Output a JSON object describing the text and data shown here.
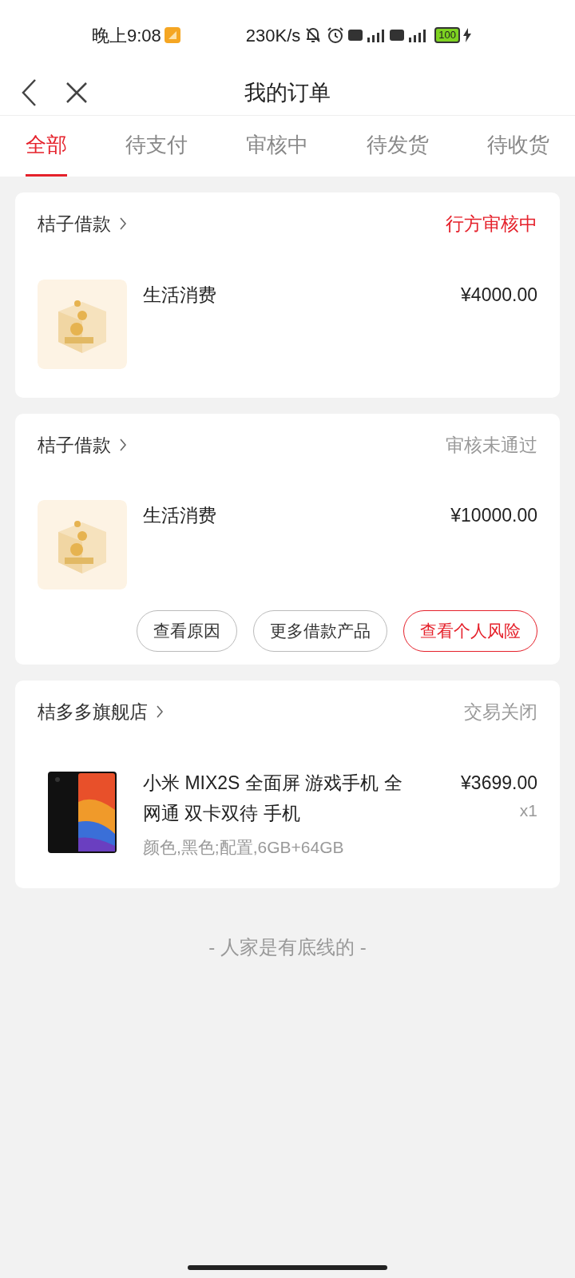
{
  "status_bar": {
    "time": "晚上9:08",
    "speed": "230K/s",
    "battery": "100"
  },
  "header": {
    "title": "我的订单"
  },
  "tabs": [
    {
      "label": "全部",
      "selected": true
    },
    {
      "label": "待支付",
      "selected": false
    },
    {
      "label": "审核中",
      "selected": false
    },
    {
      "label": "待发货",
      "selected": false
    },
    {
      "label": "待收货",
      "selected": false
    }
  ],
  "orders": [
    {
      "shop": "桔子借款",
      "status": "行方审核中",
      "kind": "active",
      "items": [
        {
          "kind": "loan",
          "name": "生活消费",
          "price": "¥4000.00"
        }
      ]
    },
    {
      "shop": "桔子借款",
      "status": "审核未通过",
      "kind": "closed",
      "items": [
        {
          "kind": "loan",
          "name": "生活消费",
          "price": "¥10000.00"
        }
      ],
      "buttons": [
        {
          "label": "查看原因",
          "kind": "outline"
        },
        {
          "label": "更多借款产品",
          "kind": "outline"
        },
        {
          "label": "查看个人风险",
          "kind": "primary"
        }
      ]
    },
    {
      "shop": "桔多多旗舰店",
      "status": "交易关闭",
      "kind": "closed",
      "items": [
        {
          "kind": "phone",
          "name": "小米 MIX2S 全面屏 游戏手机 全网通 双卡双待 手机",
          "spec": "颜色,黑色;配置,6GB+64GB",
          "price": "¥3699.00",
          "quantity": "x1"
        }
      ]
    }
  ],
  "footer": "- 人家是有底线的 -"
}
